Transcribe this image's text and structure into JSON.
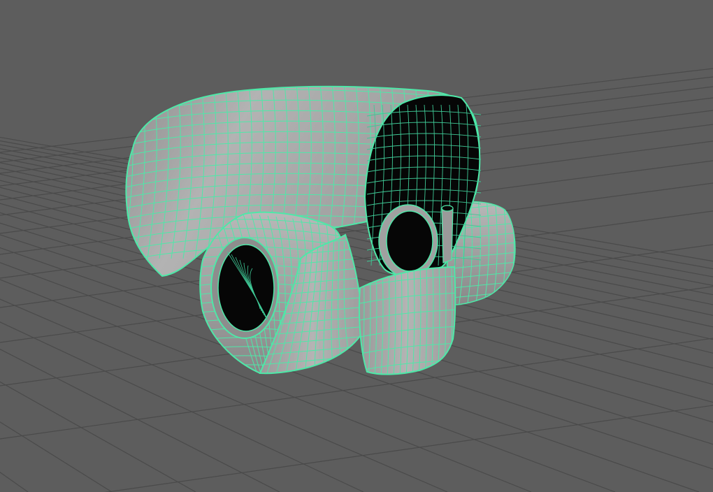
{
  "viewport": {
    "background_color": "#5d5d5d",
    "grid_color": "#4a4a4a",
    "grid_visible": true
  },
  "model": {
    "selected": true,
    "display_mode": "shaded-with-wireframe-on-shaded",
    "wireframe_color": "#4ee8a8",
    "surface_color": "#a8a8a8",
    "interior_color": "#060606",
    "parts": [
      "hood-shell",
      "left-tube",
      "right-tube",
      "center-flap",
      "chin-panel"
    ]
  }
}
